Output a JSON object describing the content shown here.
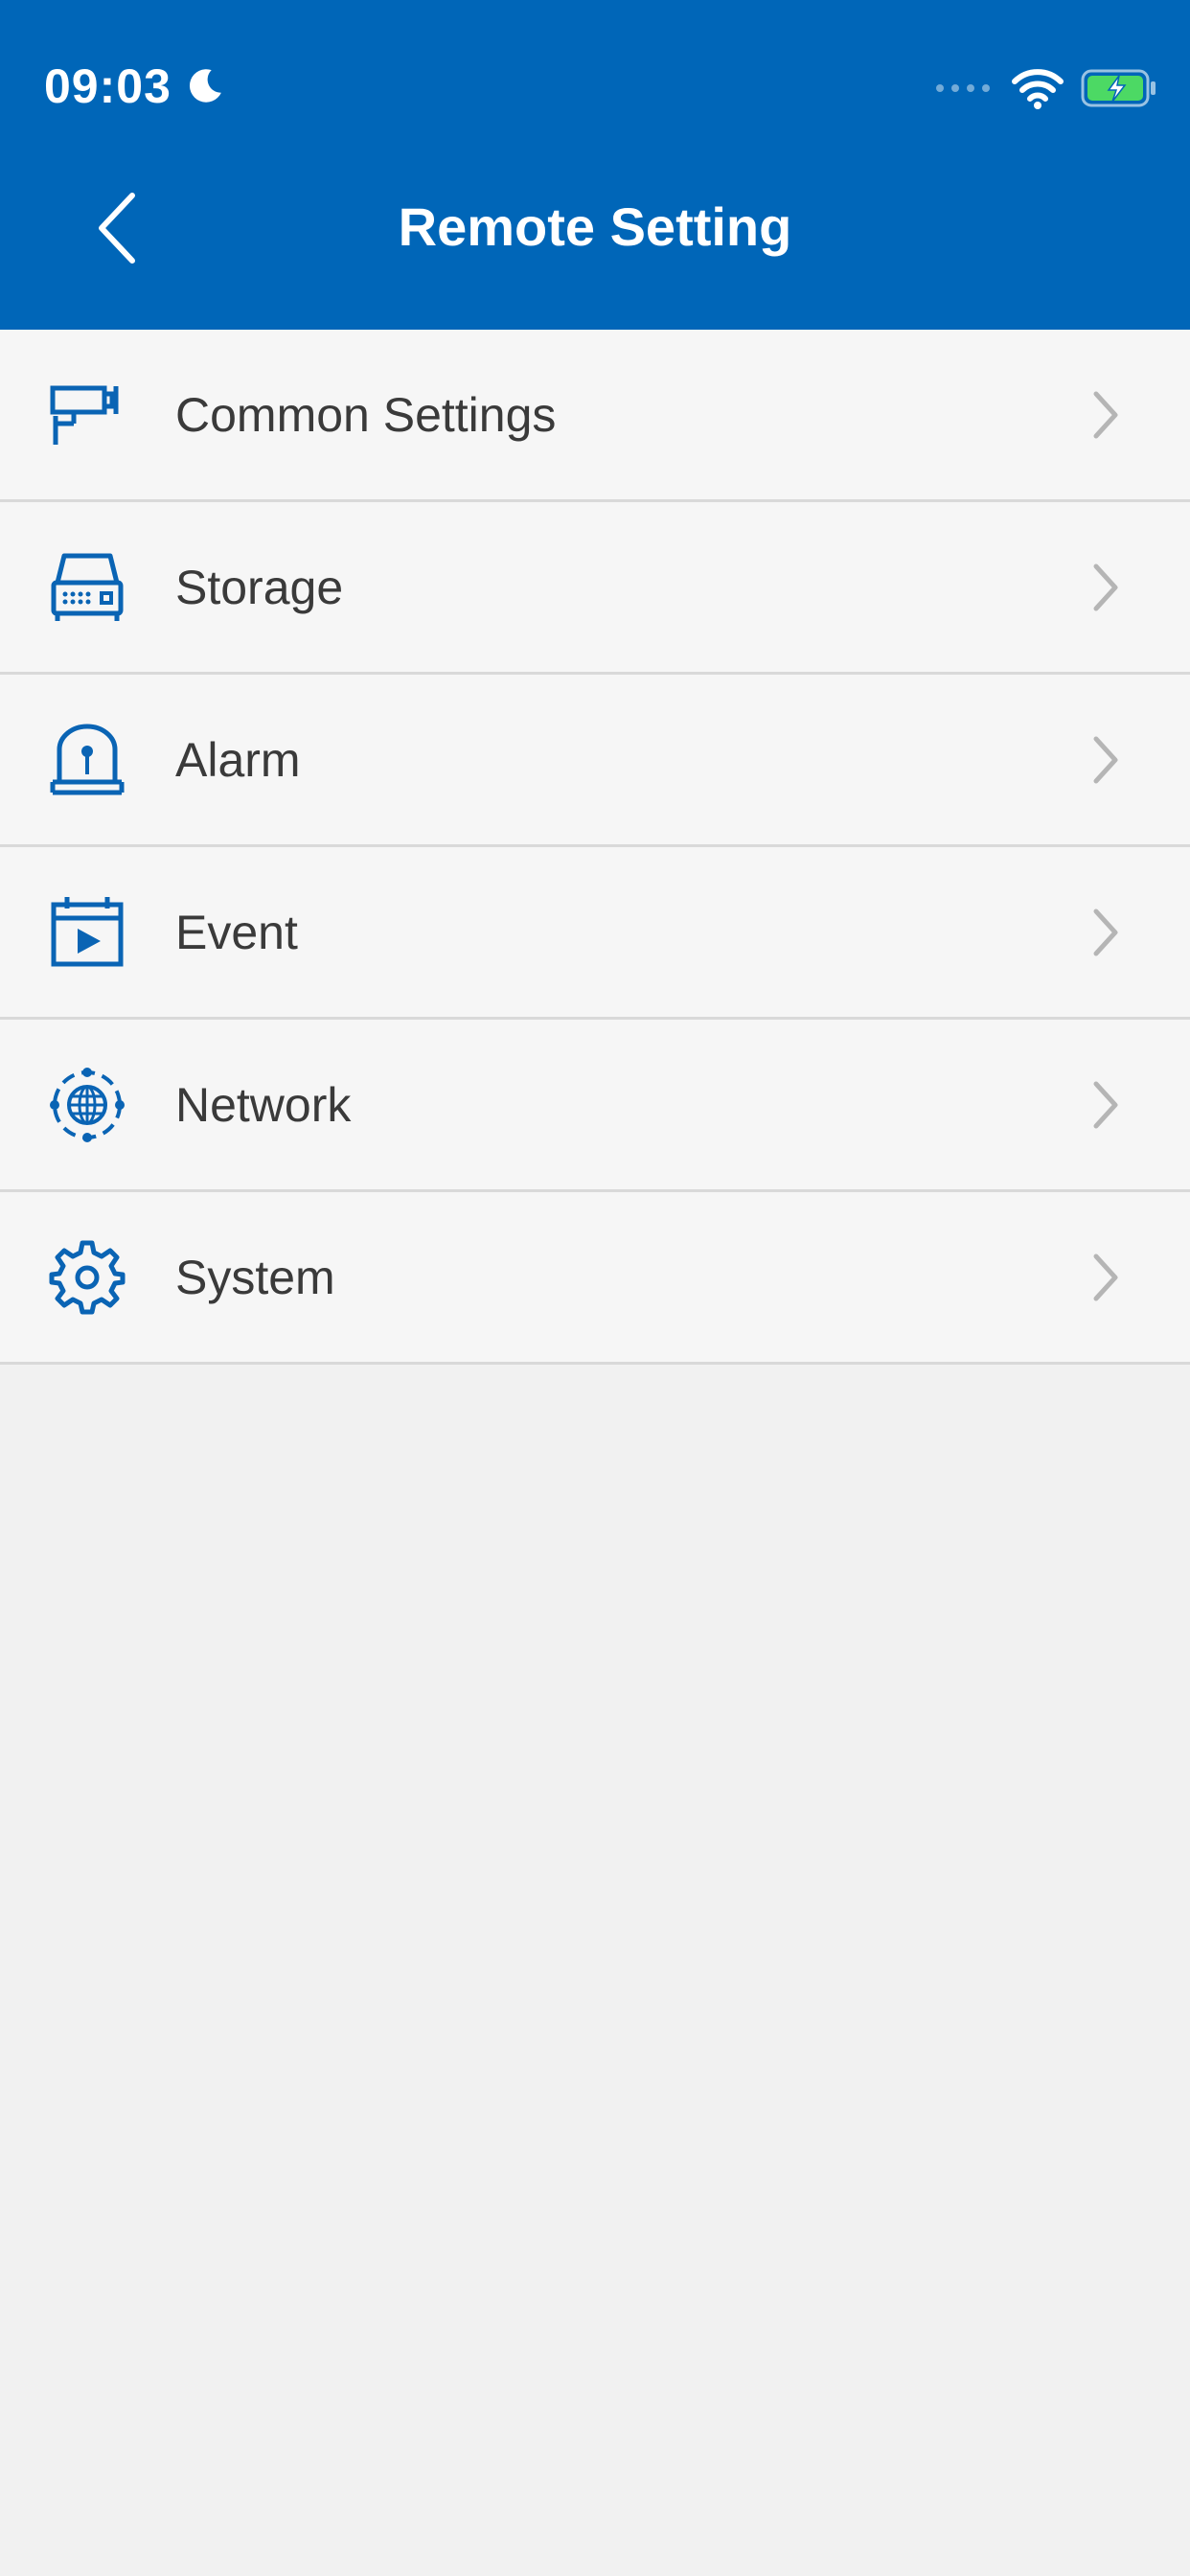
{
  "status_bar": {
    "time": "09:03",
    "icons": [
      "moon-icon",
      "signal-icon",
      "wifi-icon",
      "battery-charging-icon"
    ]
  },
  "header": {
    "title": "Remote Setting",
    "back_icon": "chevron-left-icon"
  },
  "colors": {
    "primary": "#0066b8",
    "icon_blue": "#0a64b4",
    "battery_green": "#4cd964",
    "background": "#f1f1f1",
    "row_background": "#f6f6f6",
    "divider": "#d9d9d9",
    "chevron": "#b5b5b5",
    "label_text": "#3a3a3a"
  },
  "menu": {
    "items": [
      {
        "label": "Common Settings",
        "icon": "camera-icon"
      },
      {
        "label": "Storage",
        "icon": "storage-icon"
      },
      {
        "label": "Alarm",
        "icon": "alarm-icon"
      },
      {
        "label": "Event",
        "icon": "event-icon"
      },
      {
        "label": "Network",
        "icon": "network-icon"
      },
      {
        "label": "System",
        "icon": "gear-icon"
      }
    ]
  }
}
